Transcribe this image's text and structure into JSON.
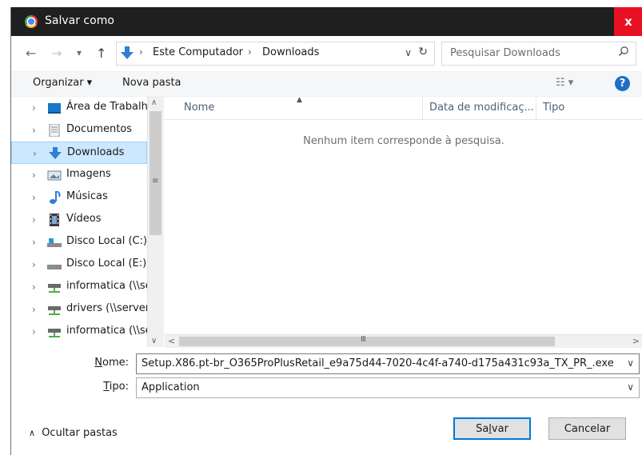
{
  "window": {
    "title": "Salvar como",
    "close_glyph": "x"
  },
  "address": {
    "back_glyph": "←",
    "forward_glyph": "→",
    "recent_glyph": "▾",
    "up_glyph": "↑",
    "crumbs": [
      "Este Computador",
      "Downloads"
    ],
    "crumb_sep": "›",
    "dropdown_glyph": "∨",
    "refresh_glyph": "↻"
  },
  "search": {
    "placeholder": "Pesquisar Downloads",
    "icon": "search-icon"
  },
  "toolbar": {
    "organize_label": "Organizar ▾",
    "new_folder_label": "Nova pasta",
    "views_label": "☷ ▾",
    "help_glyph": "?"
  },
  "sidebar": {
    "items": [
      {
        "label": "Área de Trabalho",
        "icon": "desktop-icon"
      },
      {
        "label": "Documentos",
        "icon": "documents-icon"
      },
      {
        "label": "Downloads",
        "icon": "downloads-icon",
        "selected": true
      },
      {
        "label": "Imagens",
        "icon": "pictures-icon"
      },
      {
        "label": "Músicas",
        "icon": "music-icon"
      },
      {
        "label": "Vídeos",
        "icon": "videos-icon"
      },
      {
        "label": "Disco Local (C:)",
        "icon": "drive-c-icon"
      },
      {
        "label": "Disco Local (E:)",
        "icon": "drive-e-icon"
      },
      {
        "label": "informatica (\\\\se",
        "icon": "network-drive-icon"
      },
      {
        "label": "drivers (\\\\serverf",
        "icon": "network-drive-icon"
      },
      {
        "label": "informatica (\\\\se",
        "icon": "network-drive-icon"
      }
    ],
    "chevron": "›"
  },
  "filelist": {
    "columns": [
      "Nome",
      "Data de modificaç...",
      "Tipo"
    ],
    "empty_message": "Nenhum item corresponde à pesquisa."
  },
  "form": {
    "name_label_u": "N",
    "name_label_rest": "ome:",
    "filename": "Setup.X86.pt-br_O365ProPlusRetail_e9a75d44-7020-4c4f-a740-d175a431c93a_TX_PR_.exe",
    "type_label_u": "T",
    "type_label_rest": "ipo:",
    "type_value": "Application"
  },
  "footer": {
    "hide_folders_label": "Ocultar pastas",
    "save_label_pre": "Sa",
    "save_label_u": "l",
    "save_label_post": "var",
    "cancel_label": "Cancelar"
  },
  "colors": {
    "accent": "#0078d7",
    "selection": "#cce8ff",
    "close": "#e81123",
    "titlebar": "#1f1f1f"
  }
}
